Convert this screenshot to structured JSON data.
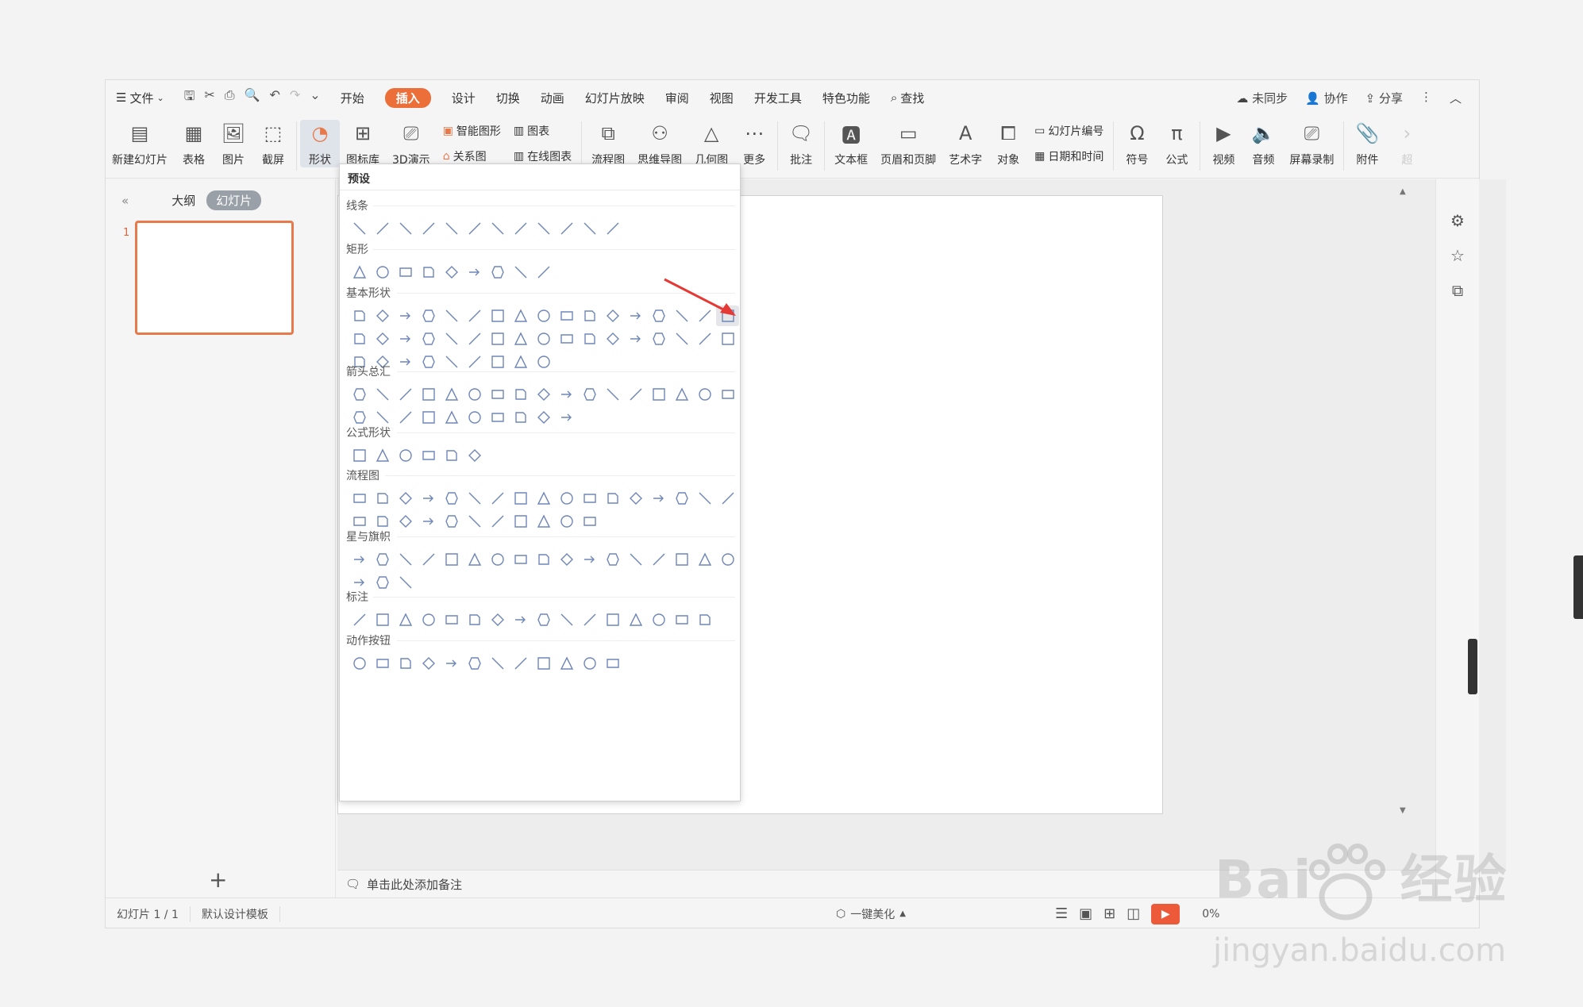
{
  "menubar": {
    "file": "文件",
    "tabs": [
      "开始",
      "插入",
      "设计",
      "切换",
      "动画",
      "幻灯片放映",
      "审阅",
      "视图",
      "开发工具",
      "特色功能"
    ],
    "active_tab": "插入",
    "search": "查找",
    "unsync": "未同步",
    "collab": "协作",
    "share": "分享"
  },
  "ribbon": {
    "new_slide": "新建幻灯片",
    "table": "表格",
    "picture": "图片",
    "screenshot": "截屏",
    "shape": "形状",
    "icon_lib": "图标库",
    "three_d": "3D演示",
    "smart_shape": "智能图形",
    "chart": "图表",
    "relation": "关系图",
    "online_chart": "在线图表",
    "flowchart": "流程图",
    "mindmap": "思维导图",
    "geometry": "几何图",
    "more": "更多",
    "comment": "批注",
    "textbox": "文本框",
    "header_footer": "页眉和页脚",
    "wordart": "艺术字",
    "object": "对象",
    "slide_number": "幻灯片编号",
    "datetime": "日期和时间",
    "symbol": "符号",
    "formula": "公式",
    "video": "视频",
    "audio": "音频",
    "screen_record": "屏幕录制",
    "attachment": "附件",
    "overflow": "超"
  },
  "leftpanel": {
    "outline": "大纲",
    "slides": "幻灯片",
    "slide_num": "1"
  },
  "dropdown": {
    "title": "预设",
    "sections": [
      "线条",
      "矩形",
      "基本形状",
      "箭头总汇",
      "公式形状",
      "流程图",
      "星与旗帜",
      "标注",
      "动作按钮"
    ]
  },
  "notes": {
    "placeholder": "单击此处添加备注"
  },
  "statusbar": {
    "slide_count": "幻灯片 1 / 1",
    "template": "默认设计模板",
    "beautify": "一键美化",
    "zoom": "0%"
  },
  "watermark": {
    "brand": "Bai",
    "brand2": "经验",
    "url": "jingyan.baidu.com"
  },
  "colors": {
    "accent": "#ec6f3a",
    "shape_stroke": "#6f86b8",
    "annot": "#e53935"
  }
}
